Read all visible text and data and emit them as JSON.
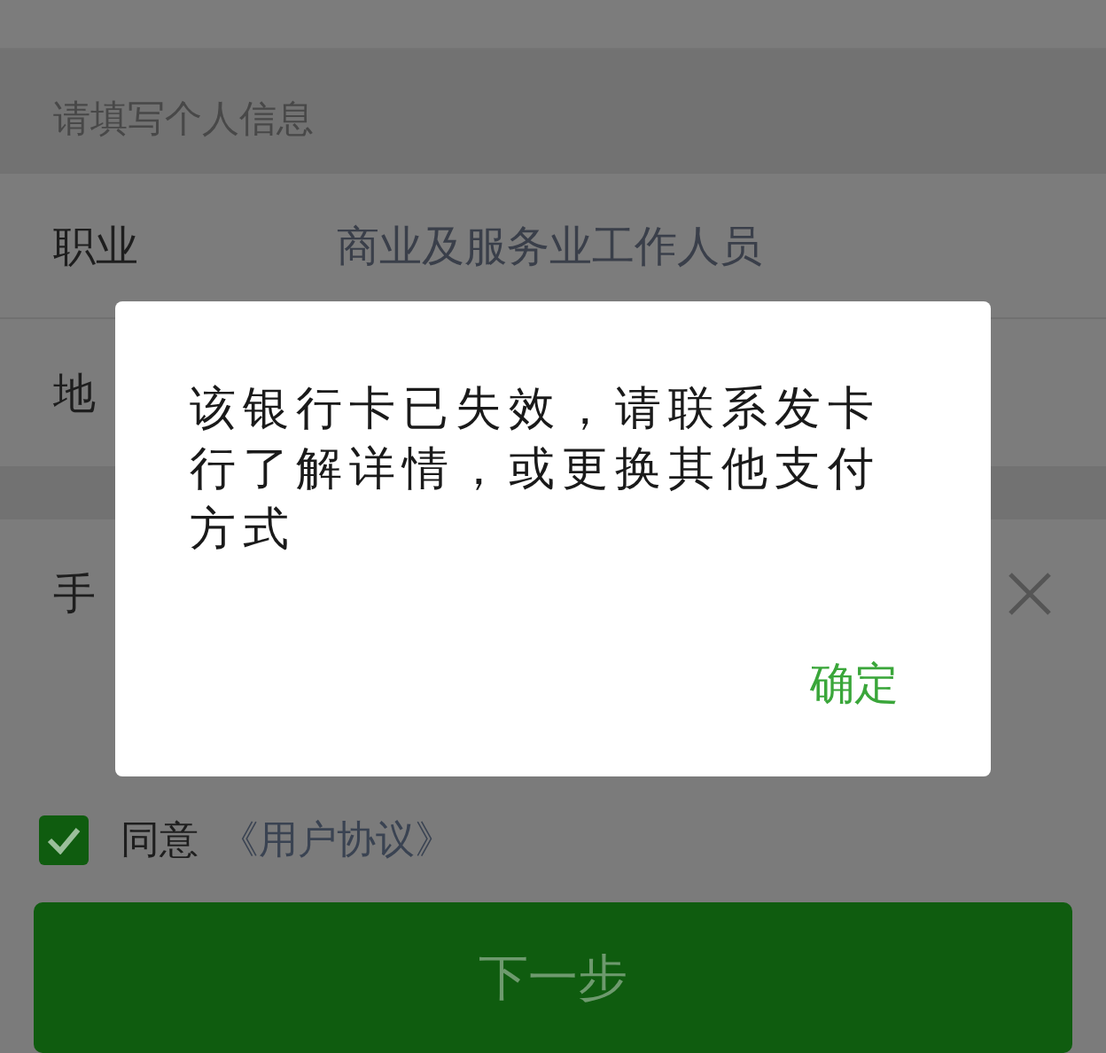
{
  "section_header": "请填写个人信息",
  "fields": [
    {
      "label": "职业",
      "value": "商业及服务业工作人员"
    },
    {
      "label": "地"
    }
  ],
  "phone": {
    "label": "手"
  },
  "dialog": {
    "message": "该银行卡已失效，请联系发卡行了解详情，或更换其他支付方式",
    "confirm": "确定"
  },
  "agreement": {
    "checked": true,
    "text": "同意",
    "link": "《用户协议》"
  },
  "next_button": "下一步"
}
